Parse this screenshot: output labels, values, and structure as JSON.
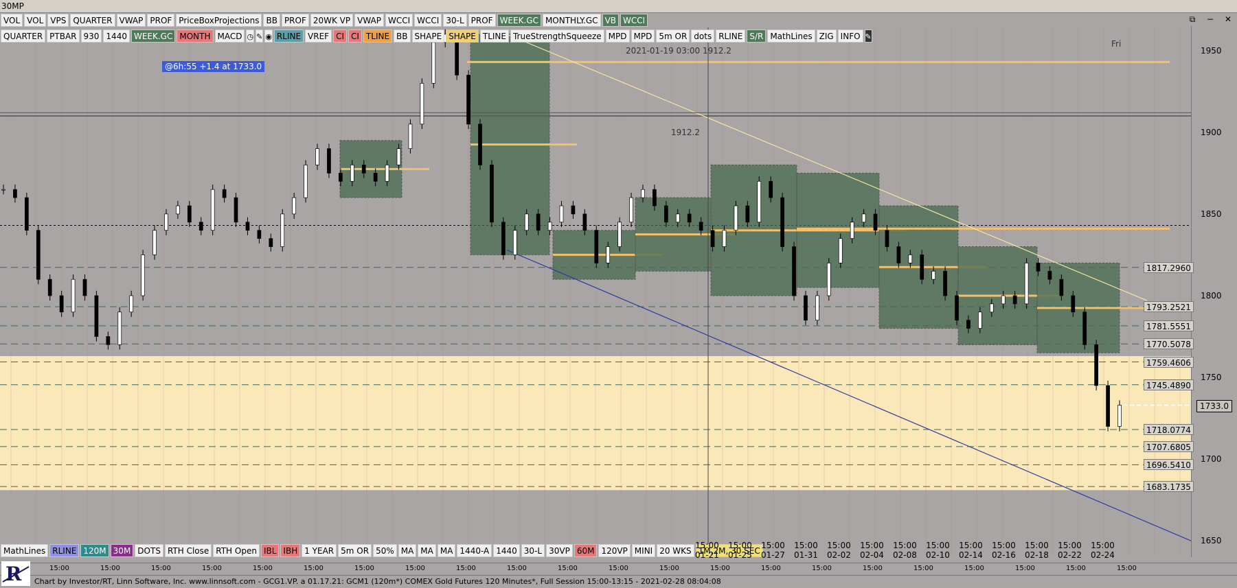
{
  "window_title": "30MP",
  "toolbar1": [
    "VOL",
    "VOL",
    "VPS",
    "QUARTER",
    "VWAP",
    "PROF",
    "PriceBoxProjections",
    "BB",
    "PROF",
    "20WK VP",
    "VWAP",
    "WCCI",
    "WCCI",
    "30-L",
    "PROF",
    "WEEK.GC",
    "MONTHLY.GC",
    "VB",
    "WCCI"
  ],
  "toolbar1_colors": {
    "WEEK.GC": "#4e7a5a",
    "VB": "#4e7a5a",
    "WCCI#3": "#4e7a5a"
  },
  "toolbar2": [
    "QUARTER",
    "PTBAR",
    "930",
    "1440",
    "WEEK.GC",
    "MONTH",
    "MACD",
    "clock-icon",
    "pencil-icon",
    "target-icon",
    "RLINE",
    "VREF",
    "CI",
    "CI",
    "TLINE",
    "BB",
    "SHAPE",
    "SHAPE",
    "TLINE",
    "TrueStrengthSqueeze",
    "MPD",
    "MPD",
    "5m OR",
    "dots",
    "RLINE",
    "S/R",
    "MathLines",
    "ZIG",
    "INFO",
    "edit-icon"
  ],
  "toolbar3": [
    "MathLines",
    "RLINE",
    "120M",
    "30M",
    "DOTS",
    "RTH Close",
    "RTH Open",
    "IBL",
    "IBH",
    "1 YEAR",
    "5m OR",
    "50%",
    "MA",
    "MA",
    "MA",
    "1440-A",
    "1440",
    "30-L",
    "30VP",
    "60M",
    "120VP",
    "MINI",
    "20 WKS",
    "1M,2M, 30 SEC"
  ],
  "info_label": "@6h:55  +1.4 at 1733.0",
  "crosshair_label": "2021-01-19 03:00  1912.2",
  "crosshair_value": "1912.2",
  "day_label": "Fri",
  "y_ticks": [
    "1950",
    "1900",
    "1850",
    "1800",
    "1750",
    "1700",
    "1650"
  ],
  "price_tags": [
    "1817.2960",
    "1793.2521",
    "1781.5551",
    "1770.5078",
    "1759.4606",
    "1745.4890",
    "1718.0774",
    "1707.6805",
    "1696.5410",
    "1683.1735"
  ],
  "current_price": "1733.0",
  "date_cols": [
    {
      "t": "15:00",
      "d": "01-21"
    },
    {
      "t": "15:00",
      "d": "01-25"
    },
    {
      "t": "15:00",
      "d": "01-27"
    },
    {
      "t": "15:00",
      "d": "01-31"
    },
    {
      "t": "15:00",
      "d": "02-02"
    },
    {
      "t": "15:00",
      "d": "02-04"
    },
    {
      "t": "15:00",
      "d": "02-08"
    },
    {
      "t": "15:00",
      "d": "02-10"
    },
    {
      "t": "15:00",
      "d": "02-14"
    },
    {
      "t": "15:00",
      "d": "02-16"
    },
    {
      "t": "15:00",
      "d": "02-18"
    },
    {
      "t": "15:00",
      "d": "02-22"
    },
    {
      "t": "15:00",
      "d": "02-24"
    }
  ],
  "time_ticks": [
    "15:00",
    "15:00",
    "15:00",
    "15:00",
    "15:00",
    "15:00",
    "15:00",
    "15:00",
    "15:00",
    "15:00",
    "15:00",
    "15:00",
    "15:00",
    "15:00",
    "15:00",
    "15:00",
    "15:00",
    "15:00",
    "15:00",
    "15:00",
    "15:00",
    "15:00"
  ],
  "footer_text": "Chart by Investor/RT, Linn Software, Inc. www.linnsoft.com - GCG1.VP.  a   01.17.21: GCM1 (120m*) COMEX Gold Futures 120 Minutes*, Full Session 15:00-13:15 - 2021-02-28 08:04:08",
  "colors": {
    "bg": "#a9a5a5",
    "zone": "#fbe8b8",
    "profile": "#476b4f",
    "poc": "#f5c06a",
    "trend": "#2c3ca0",
    "candle": "#000000"
  },
  "chart_data": {
    "type": "candlestick",
    "title": "GCM1 (120m*) COMEX Gold Futures 120 Minutes*",
    "ylim": [
      1640,
      1965
    ],
    "current": 1733.0,
    "support_resistance": [
      1817.296,
      1793.2521,
      1781.5551,
      1770.5078,
      1759.4606,
      1745.489,
      1718.0774,
      1707.6805,
      1696.541,
      1683.1735
    ],
    "close_path": [
      1865,
      1860,
      1840,
      1810,
      1800,
      1790,
      1810,
      1800,
      1775,
      1770,
      1790,
      1800,
      1825,
      1840,
      1850,
      1855,
      1845,
      1840,
      1865,
      1860,
      1845,
      1840,
      1835,
      1830,
      1850,
      1860,
      1880,
      1890,
      1875,
      1870,
      1880,
      1875,
      1870,
      1880,
      1890,
      1905,
      1930,
      1955,
      1960,
      1935,
      1905,
      1880,
      1845,
      1825,
      1840,
      1850,
      1840,
      1845,
      1855,
      1850,
      1840,
      1820,
      1830,
      1845,
      1860,
      1865,
      1855,
      1845,
      1850,
      1845,
      1840,
      1830,
      1840,
      1855,
      1845,
      1870,
      1860,
      1830,
      1800,
      1785,
      1800,
      1820,
      1835,
      1845,
      1850,
      1840,
      1830,
      1820,
      1825,
      1810,
      1815,
      1800,
      1785,
      1780,
      1790,
      1795,
      1800,
      1795,
      1820,
      1815,
      1810,
      1800,
      1790,
      1770,
      1745,
      1720,
      1733
    ]
  }
}
